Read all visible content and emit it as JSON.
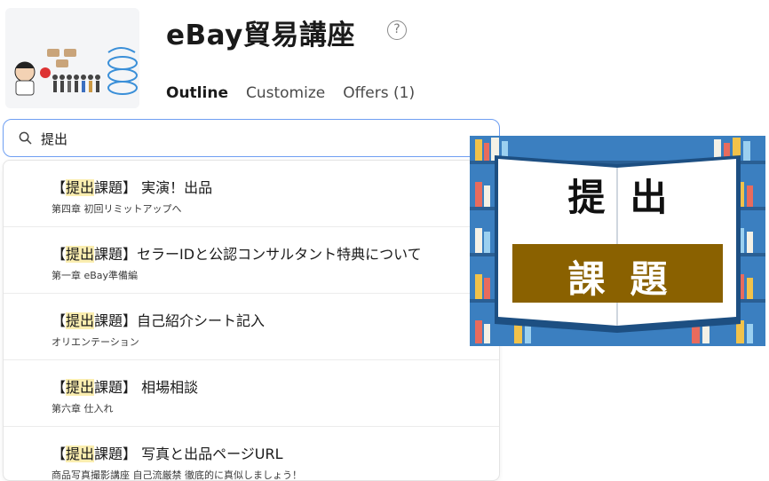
{
  "course": {
    "title": "eBay貿易講座",
    "help_icon": "question-circle-icon"
  },
  "tabs": [
    {
      "label": "Outline",
      "active": true
    },
    {
      "label": "Customize",
      "active": false
    },
    {
      "label": "Offers (1)",
      "active": false
    }
  ],
  "search": {
    "value": "提出",
    "icon": "search-icon",
    "focus_color": "#6f9ff2"
  },
  "results": [
    {
      "prefix": "【",
      "highlight": "提出",
      "rest": "課題】 実演！出品",
      "subtitle": "第四章 初回リミットアップへ"
    },
    {
      "prefix": "【",
      "highlight": "提出",
      "rest": "課題】セラーIDと公認コンサルタント特典について",
      "subtitle": "第一章 eBay準備編"
    },
    {
      "prefix": "【",
      "highlight": "提出",
      "rest": "課題】自己紹介シート記入",
      "subtitle": "オリエンテーション"
    },
    {
      "prefix": "【",
      "highlight": "提出",
      "rest": "課題】 相場相談",
      "subtitle": "第六章 仕入れ"
    },
    {
      "prefix": "【",
      "highlight": "提出",
      "rest": "課題】 写真と出品ページURL",
      "subtitle": "商品写真撮影講座 自己流厳禁 徹底的に真似しましょう！"
    }
  ],
  "highlight_color": "#fbeeb0",
  "banner": {
    "top_text": "提出",
    "bottom_text": "課題",
    "bottom_bg": "#8a6100",
    "shelf_color": "#3b7fc0"
  }
}
